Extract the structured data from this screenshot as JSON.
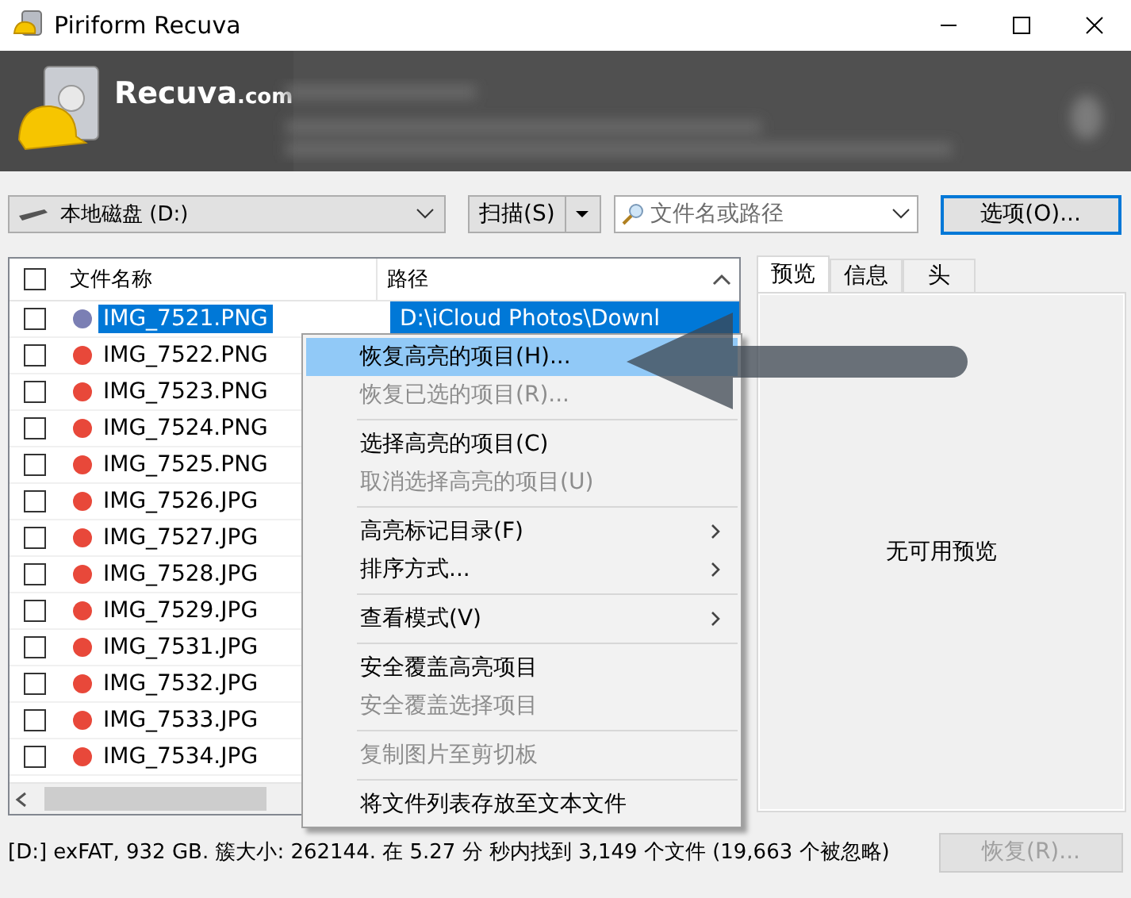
{
  "window": {
    "title": "Piriform Recuva",
    "logo_text": "Recuva",
    "logo_suffix": ".com"
  },
  "toolbar": {
    "drive": "本地磁盘 (D:)",
    "scan_button": "扫描(S)",
    "search": {
      "placeholder": "文件名或路径"
    },
    "options_button": "选项(O)..."
  },
  "file_list": {
    "columns": [
      "文件名称",
      "路径"
    ],
    "all_checked": false,
    "rows": [
      {
        "name": "IMG_7521.PNG",
        "path": "D:\\iCloud Photos\\Downl",
        "checked": false,
        "selected": true,
        "color": "#7b7fb4"
      },
      {
        "name": "IMG_7522.PNG",
        "checked": false,
        "selected": false,
        "color": "#e8483a"
      },
      {
        "name": "IMG_7523.PNG",
        "checked": false,
        "selected": false,
        "color": "#e8483a"
      },
      {
        "name": "IMG_7524.PNG",
        "checked": false,
        "selected": false,
        "color": "#e8483a"
      },
      {
        "name": "IMG_7525.PNG",
        "checked": false,
        "selected": false,
        "color": "#e8483a"
      },
      {
        "name": "IMG_7526.JPG",
        "checked": false,
        "selected": false,
        "color": "#e8483a"
      },
      {
        "name": "IMG_7527.JPG",
        "checked": false,
        "selected": false,
        "color": "#e8483a"
      },
      {
        "name": "IMG_7528.JPG",
        "checked": false,
        "selected": false,
        "color": "#e8483a"
      },
      {
        "name": "IMG_7529.JPG",
        "checked": false,
        "selected": false,
        "color": "#e8483a"
      },
      {
        "name": "IMG_7531.JPG",
        "checked": false,
        "selected": false,
        "color": "#e8483a"
      },
      {
        "name": "IMG_7532.JPG",
        "checked": false,
        "selected": false,
        "color": "#e8483a"
      },
      {
        "name": "IMG_7533.JPG",
        "checked": false,
        "selected": false,
        "color": "#e8483a"
      },
      {
        "name": "IMG_7534.JPG",
        "checked": false,
        "selected": false,
        "color": "#e8483a"
      }
    ]
  },
  "context_menu": [
    {
      "kind": "item",
      "label": "恢复高亮的项目(H)...",
      "disabled": false,
      "highlighted": true,
      "submenu": false
    },
    {
      "kind": "item",
      "label": "恢复已选的项目(R)...",
      "disabled": true,
      "highlighted": false,
      "submenu": false
    },
    {
      "kind": "separator"
    },
    {
      "kind": "item",
      "label": "选择高亮的项目(C)",
      "disabled": false,
      "highlighted": false,
      "submenu": false
    },
    {
      "kind": "item",
      "label": "取消选择高亮的项目(U)",
      "disabled": true,
      "highlighted": false,
      "submenu": false
    },
    {
      "kind": "separator"
    },
    {
      "kind": "item",
      "label": "高亮标记目录(F)",
      "disabled": false,
      "highlighted": false,
      "submenu": true
    },
    {
      "kind": "item",
      "label": "排序方式...",
      "disabled": false,
      "highlighted": false,
      "submenu": true
    },
    {
      "kind": "separator"
    },
    {
      "kind": "item",
      "label": "查看模式(V)",
      "disabled": false,
      "highlighted": false,
      "submenu": true
    },
    {
      "kind": "separator"
    },
    {
      "kind": "item",
      "label": "安全覆盖高亮项目",
      "disabled": false,
      "highlighted": false,
      "submenu": false
    },
    {
      "kind": "item",
      "label": "安全覆盖选择项目",
      "disabled": true,
      "highlighted": false,
      "submenu": false
    },
    {
      "kind": "separator"
    },
    {
      "kind": "item",
      "label": "复制图片至剪切板",
      "disabled": true,
      "highlighted": false,
      "submenu": false
    },
    {
      "kind": "separator"
    },
    {
      "kind": "item",
      "label": "将文件列表存放至文本文件",
      "disabled": false,
      "highlighted": false,
      "submenu": false
    }
  ],
  "preview_panel": {
    "tabs": [
      {
        "label": "预览",
        "selected": true
      },
      {
        "label": "信息",
        "selected": false
      },
      {
        "label": "头",
        "selected": false
      }
    ],
    "message": "无可用预览"
  },
  "status_bar": {
    "text": "[D:] exFAT, 932 GB. 簇大小: 262144. 在 5.27 分 秒内找到 3,149 个文件 (19,663 个被忽略)",
    "recover_button": {
      "label": "恢复(R)...",
      "disabled": true
    }
  }
}
